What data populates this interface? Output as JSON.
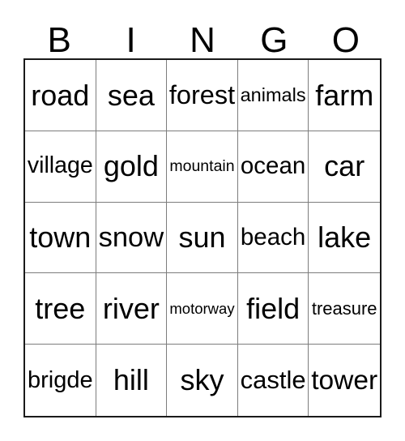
{
  "card": {
    "headers": [
      "B",
      "I",
      "N",
      "G",
      "O"
    ],
    "rows": [
      [
        "road",
        "sea",
        "forest",
        "animals",
        "farm"
      ],
      [
        "village",
        "gold",
        "mountain",
        "ocean",
        "car"
      ],
      [
        "town",
        "snow",
        "sun",
        "beach",
        "lake"
      ],
      [
        "tree",
        "river",
        "motorway",
        "field",
        "treasure"
      ],
      [
        "brigde",
        "hill",
        "sky",
        "castle",
        "tower"
      ]
    ],
    "colors": {
      "background": "#ffffff",
      "text": "#000000",
      "outer_border": "#1a1a1a",
      "grid_line": "#7d7d7d"
    }
  }
}
